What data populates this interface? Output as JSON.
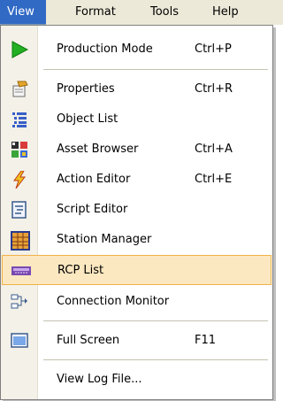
{
  "menubar": {
    "items": [
      {
        "label": "View",
        "active": true
      },
      {
        "label": "Format"
      },
      {
        "label": "Tools"
      },
      {
        "label": "Help"
      }
    ]
  },
  "menu": {
    "items": [
      {
        "label": "Production Mode",
        "shortcut": "Ctrl+P",
        "icon": "play-icon"
      },
      {
        "label": "Properties",
        "shortcut": "Ctrl+R",
        "icon": "properties-icon"
      },
      {
        "label": "Object List",
        "shortcut": "",
        "icon": "object-list-icon"
      },
      {
        "label": "Asset Browser",
        "shortcut": "Ctrl+A",
        "icon": "asset-browser-icon"
      },
      {
        "label": "Action Editor",
        "shortcut": "Ctrl+E",
        "icon": "lightning-icon"
      },
      {
        "label": "Script Editor",
        "shortcut": "",
        "icon": "script-icon"
      },
      {
        "label": "Station Manager",
        "shortcut": "",
        "icon": "station-manager-icon"
      },
      {
        "label": "RCP List",
        "shortcut": "",
        "icon": "rcp-list-icon",
        "highlighted": true
      },
      {
        "label": "Connection Monitor",
        "shortcut": "",
        "icon": "connection-monitor-icon"
      },
      {
        "label": "Full Screen",
        "shortcut": "F11",
        "icon": "full-screen-icon"
      },
      {
        "label": "View Log File...",
        "shortcut": "",
        "icon": ""
      }
    ]
  },
  "colors": {
    "menubar_bg": "#ece9d8",
    "active_menu_bg": "#316ac5",
    "highlight_bg": "#fbe8c0",
    "highlight_border": "#f0b24a",
    "gutter_bg": "#f3f1e8"
  }
}
